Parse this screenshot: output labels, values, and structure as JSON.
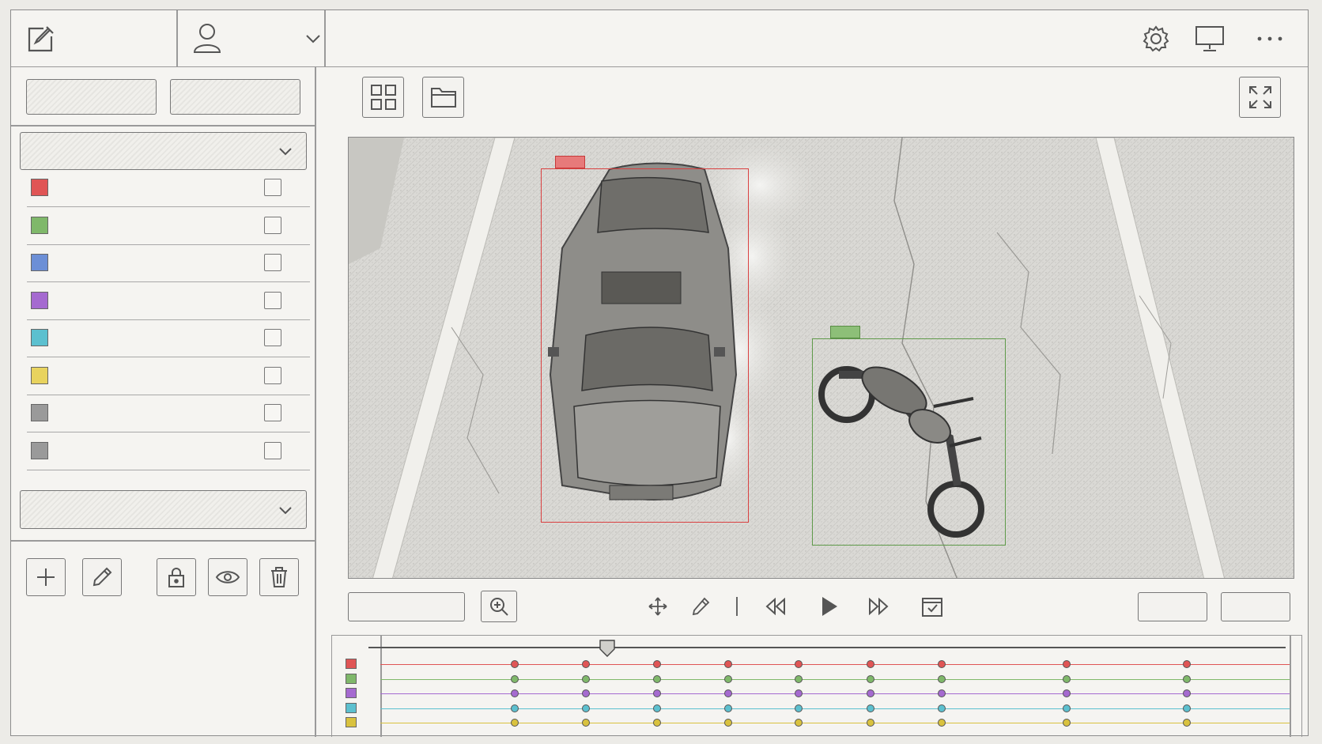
{
  "header": {
    "icons": [
      "edit-icon",
      "user-icon",
      "chevron-down-icon",
      "gear-icon",
      "monitor-icon",
      "more-icon"
    ]
  },
  "toolbar": {
    "icons": [
      "grid-icon",
      "folder-icon",
      "fullscreen-icon"
    ]
  },
  "sidebar": {
    "label_colors": [
      "#e05555",
      "#7fb86a",
      "#6c8fd6",
      "#a56ad0",
      "#5cc0cf",
      "#e8d35e",
      "#9a9a9a",
      "#9a9a9a"
    ],
    "actions": [
      "add-icon",
      "pencil-icon",
      "lock-icon",
      "eye-icon",
      "trash-icon"
    ]
  },
  "annotations": [
    {
      "label_color": "#d94040",
      "object": "car"
    },
    {
      "label_color": "#5f9a4a",
      "object": "motorcycle"
    }
  ],
  "playback": {
    "icons": [
      "zoom-in-icon",
      "move-icon",
      "eyedropper-icon",
      "rewind-icon",
      "play-icon",
      "fast-forward-icon",
      "checklist-icon"
    ]
  },
  "timeline": {
    "track_colors": [
      "#e05555",
      "#7fb86a",
      "#a56ad0",
      "#5cc0cf",
      "#d9c23e"
    ],
    "playhead_position": 0.24
  }
}
